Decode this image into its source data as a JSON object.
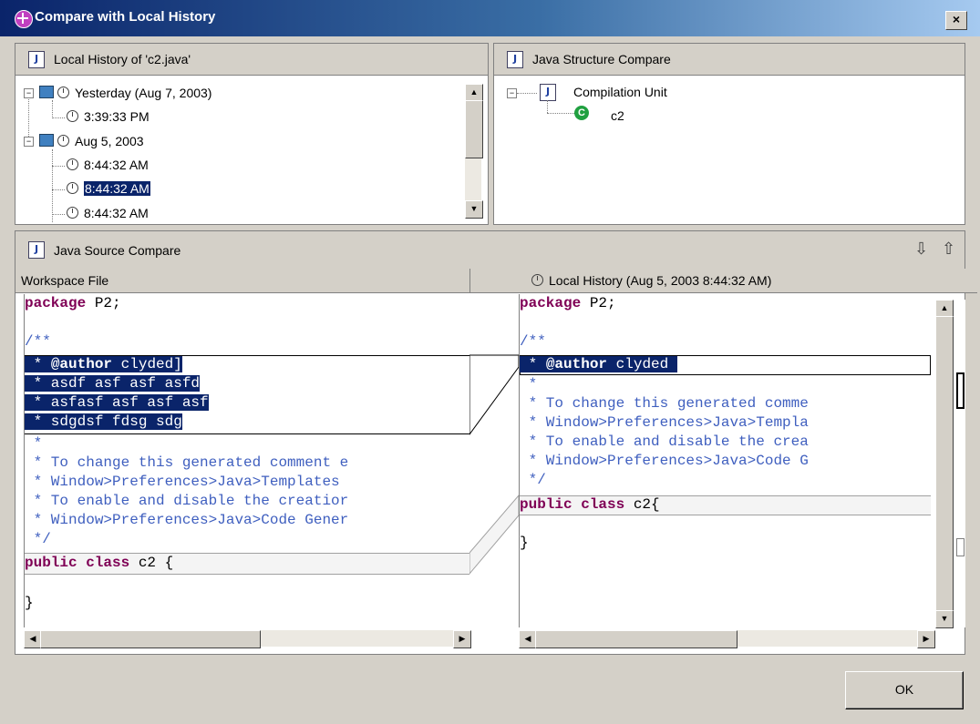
{
  "window": {
    "title": "Compare with Local History",
    "close": "×"
  },
  "history_pane": {
    "title": "Local History of 'c2.java'",
    "groups": [
      {
        "label": "Yesterday (Aug 7, 2003)",
        "items": [
          "3:39:33 PM"
        ]
      },
      {
        "label": "Aug 5, 2003",
        "items": [
          "8:44:32 AM",
          "8:44:32 AM",
          "8:44:32 AM"
        ]
      }
    ],
    "selected_item": "8:44:32 AM"
  },
  "structure_pane": {
    "title": "Java Structure Compare",
    "root": "Compilation Unit",
    "child": "c2",
    "child_badge": "C"
  },
  "source_pane": {
    "title": "Java Source Compare",
    "left_header": "Workspace File",
    "right_header": "Local History (Aug 5, 2003 8:44:32 AM)",
    "left_code": {
      "l1_kw": "package",
      "l1_rest": " P2;",
      "l3": "/**",
      "l4_star": " * ",
      "l4_tag": "@author",
      "l4_rest": " clyded]",
      "l5": " * asdf asf asf asfd",
      "l6": " * asfasf asf asf asf",
      "l7": " * sdgdsf fdsg sdg",
      "l8": " *",
      "l9": " * To change this generated comment e",
      "l10": " * Window>Preferences>Java>Templates",
      "l11": " * To enable and disable the creatior",
      "l12": " * Window>Preferences>Java>Code Gener",
      "l13": " */",
      "l14_kw": "public class",
      "l14_rest": " c2 {",
      "l16": "}"
    },
    "right_code": {
      "l1_kw": "package",
      "l1_rest": " P2;",
      "l3": "/**",
      "l4_star": " * ",
      "l4_tag": "@author",
      "l4_rest": " clyded",
      "l5": " *",
      "l6": " * To change this generated comme",
      "l7": " * Window>Preferences>Java>Templa",
      "l8": " * To enable and disable the crea",
      "l9": " * Window>Preferences>Java>Code G",
      "l10": " */",
      "l11_kw": "public class",
      "l11_rest": " c2{",
      "l13": "}"
    }
  },
  "buttons": {
    "ok": "OK"
  },
  "icons": {
    "down": "⇩",
    "up": "⇧"
  }
}
